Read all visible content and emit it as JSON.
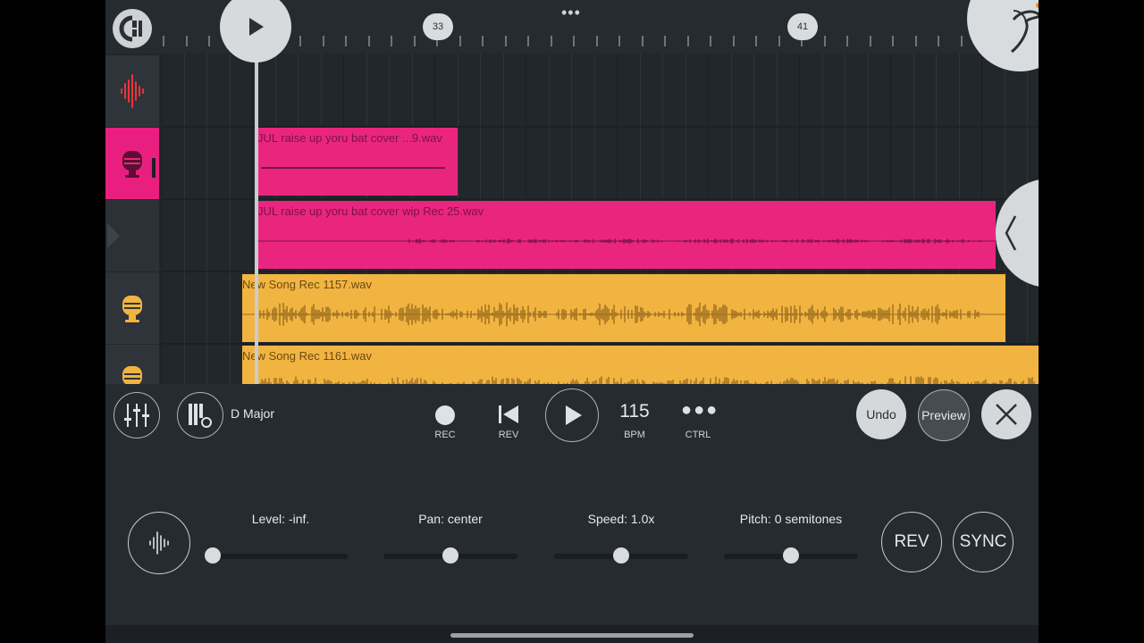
{
  "ruler": {
    "bar_markers": [
      "33",
      "41"
    ],
    "menu_icon": "more-dots-icon"
  },
  "tracks": {
    "clips": [
      {
        "name": "JUL raise up yoru bat cover ...9.wav",
        "color": "#ea2580"
      },
      {
        "name": "JUL raise up yoru bat cover wip Rec 25.wav",
        "color": "#ea2580"
      },
      {
        "name": "New Song Rec 1157.wav",
        "color": "#f2b441"
      },
      {
        "name": "New Song Rec 1161.wav",
        "color": "#f2b441"
      }
    ]
  },
  "transport": {
    "key": "D Major",
    "rec_label": "REC",
    "rev_label": "REV",
    "bpm_value": "115",
    "bpm_label": "BPM",
    "ctrl_label": "CTRL",
    "undo_label": "Undo",
    "preview_label": "Preview"
  },
  "clip_props": {
    "level_label": "Level: -inf.",
    "pan_label": "Pan: center",
    "speed_label": "Speed: 1.0x",
    "pitch_label": "Pitch: 0 semitones",
    "level_value": 0.0,
    "pan_value": 0.5,
    "speed_value": 0.5,
    "pitch_value": 0.5,
    "rev_button": "REV",
    "sync_button": "SYNC"
  },
  "colors": {
    "accent_pink": "#ea2580",
    "accent_orange": "#f2b441",
    "waveform_red": "#e8353b",
    "background": "#262b30"
  }
}
